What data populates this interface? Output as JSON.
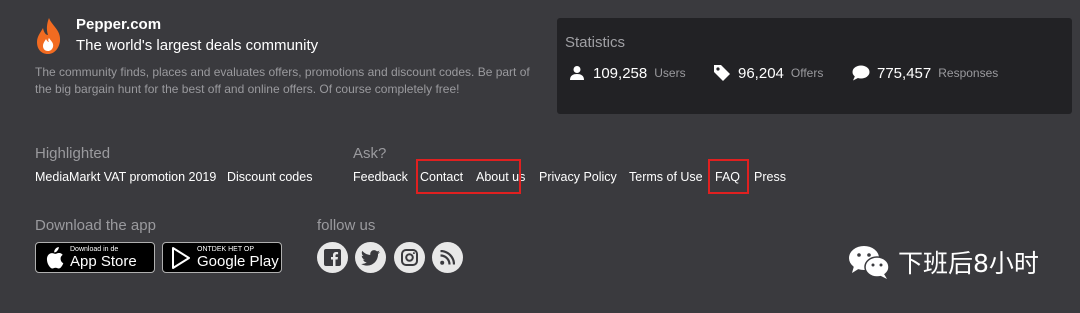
{
  "brand": {
    "name": "Pepper.com",
    "tagline": "The world's largest deals community",
    "description": "The community finds, places and evaluates offers, promotions and discount codes. Be part of the big bargain hunt for the best off and online offers. Of course completely free!",
    "logo_icon": "flame-icon",
    "logo_color": "#f26b21"
  },
  "stats": {
    "title": "Statistics",
    "items": [
      {
        "icon": "user-icon",
        "value": "109,258",
        "label": "Users"
      },
      {
        "icon": "tag-icon",
        "value": "96,204",
        "label": "Offers"
      },
      {
        "icon": "comment-icon",
        "value": "775,457",
        "label": "Responses"
      }
    ]
  },
  "highlighted": {
    "title": "Highlighted",
    "links": [
      "MediaMarkt VAT promotion 2019",
      "Discount codes"
    ]
  },
  "ask": {
    "title": "Ask?",
    "links": [
      "Feedback",
      "Contact",
      "About us",
      "Privacy Policy",
      "Terms of Use",
      "FAQ",
      "Press"
    ]
  },
  "download": {
    "title": "Download the app",
    "app_store": {
      "small": "Download in de",
      "big": "App Store",
      "icon": "apple-icon"
    },
    "google_play": {
      "small": "ONTDEK HET OP",
      "big": "Google Play",
      "icon": "play-icon"
    }
  },
  "follow": {
    "title": "follow us",
    "icons": [
      "facebook-icon",
      "twitter-icon",
      "instagram-icon",
      "rss-icon"
    ]
  },
  "watermark": {
    "text": "下班后8小时",
    "icon": "wechat-icon"
  },
  "colors": {
    "background": "#3a3a3e",
    "panel": "#222225",
    "muted_text": "#9a9a9e",
    "highlight_box": "#e02020"
  }
}
